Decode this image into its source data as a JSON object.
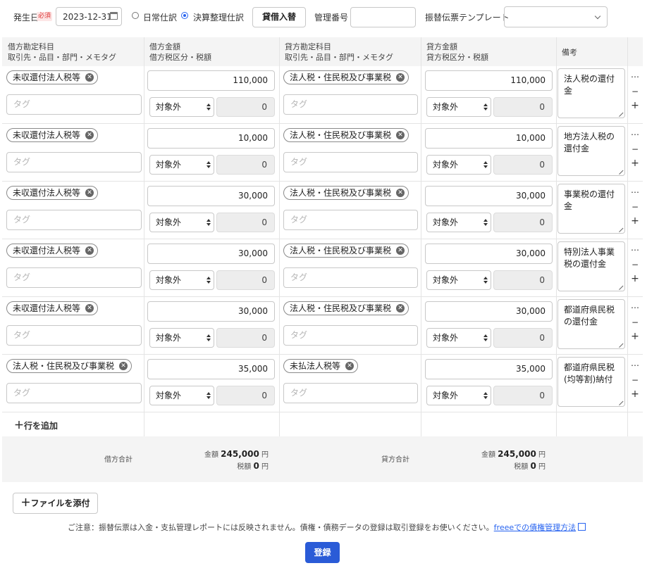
{
  "top": {
    "date_label": "発生日",
    "required_badge": "必須",
    "date_value": "2023-12-31",
    "radio_normal": "日常仕訳",
    "radio_closing": "決算整理仕訳",
    "swap_button": "貸借入替",
    "mgmt_label": "管理番号",
    "mgmt_value": "",
    "template_label": "振替伝票テンプレート",
    "template_value": ""
  },
  "headers": {
    "debit_account": [
      "借方勘定科目",
      "取引先・品目・部門・メモタグ"
    ],
    "debit_amount": [
      "借方金額",
      "借方税区分・税額"
    ],
    "credit_account": [
      "貸方勘定科目",
      "取引先・品目・部門・メモタグ"
    ],
    "credit_amount": [
      "貸方金額",
      "貸方税区分・税額"
    ],
    "memo": "備考"
  },
  "tag_placeholder": "タグ",
  "rows": [
    {
      "debit_account": "未収還付法人税等",
      "debit_amount": "110,000",
      "debit_tax": "対象外",
      "debit_tax_amount": "0",
      "credit_account": "法人税・住民税及び事業税",
      "credit_amount": "110,000",
      "credit_tax": "対象外",
      "credit_tax_amount": "0",
      "memo": "法人税の還付金"
    },
    {
      "debit_account": "未収還付法人税等",
      "debit_amount": "10,000",
      "debit_tax": "対象外",
      "debit_tax_amount": "0",
      "credit_account": "法人税・住民税及び事業税",
      "credit_amount": "10,000",
      "credit_tax": "対象外",
      "credit_tax_amount": "0",
      "memo": "地方法人税の還付金"
    },
    {
      "debit_account": "未収還付法人税等",
      "debit_amount": "30,000",
      "debit_tax": "対象外",
      "debit_tax_amount": "0",
      "credit_account": "法人税・住民税及び事業税",
      "credit_amount": "30,000",
      "credit_tax": "対象外",
      "credit_tax_amount": "0",
      "memo": "事業税の還付金"
    },
    {
      "debit_account": "未収還付法人税等",
      "debit_amount": "30,000",
      "debit_tax": "対象外",
      "debit_tax_amount": "0",
      "credit_account": "法人税・住民税及び事業税",
      "credit_amount": "30,000",
      "credit_tax": "対象外",
      "credit_tax_amount": "0",
      "memo": "特別法人事業税の還付金"
    },
    {
      "debit_account": "未収還付法人税等",
      "debit_amount": "30,000",
      "debit_tax": "対象外",
      "debit_tax_amount": "0",
      "credit_account": "法人税・住民税及び事業税",
      "credit_amount": "30,000",
      "credit_tax": "対象外",
      "credit_tax_amount": "0",
      "memo": "都道府県民税の還付金"
    },
    {
      "debit_account": "法人税・住民税及び事業税",
      "debit_amount": "35,000",
      "debit_tax": "対象外",
      "debit_tax_amount": "0",
      "credit_account": "未払法人税等",
      "credit_amount": "35,000",
      "credit_tax": "対象外",
      "credit_tax_amount": "0",
      "memo": "都道府県民税(均等割)納付"
    }
  ],
  "add_row": "行を追加",
  "totals": {
    "debit_label": "借方合計",
    "credit_label": "貸方合計",
    "amount_label": "金額",
    "tax_label": "税額",
    "debit_amount": "245,000",
    "debit_tax": "0",
    "credit_amount": "245,000",
    "credit_tax": "0",
    "yen": "円"
  },
  "attach_button": "ファイルを添付",
  "notice_text": "ご注意：振替伝票は入金・支払管理レポートには反映されません。債権・債務データの登録は取引登録をお使いください。",
  "notice_link": "freeeでの債権管理方法",
  "submit_button": "登録"
}
